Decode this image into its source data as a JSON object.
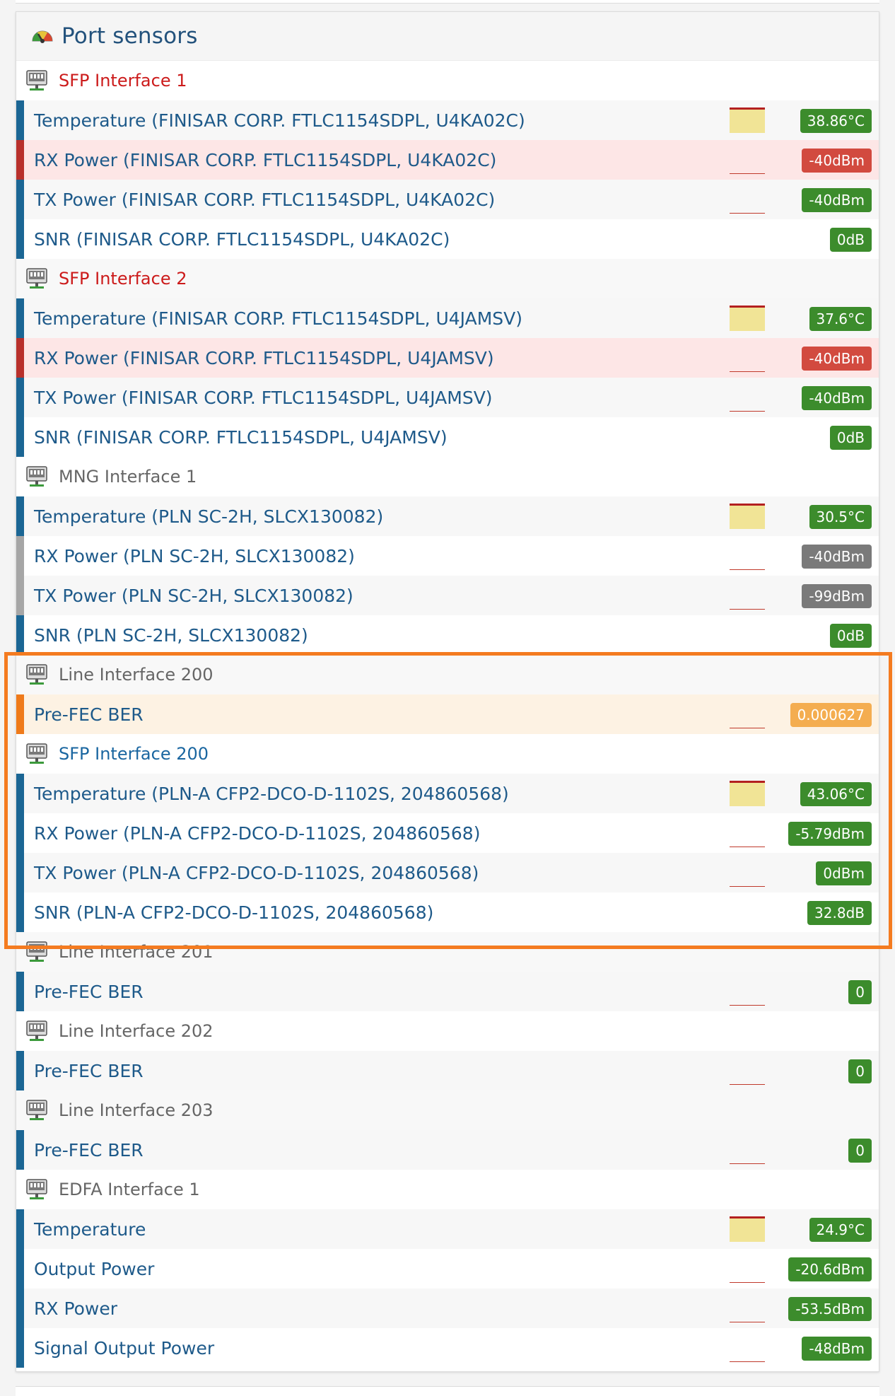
{
  "panel": {
    "title": "Port sensors",
    "icon": "gauge-icon"
  },
  "colors": {
    "accent_blue": "#1b6694",
    "ok_green": "#3c8c2c",
    "alert_red": "#d24a3f",
    "warn_orange": "#f4ad50",
    "muted_grey": "#7a7a7a",
    "highlight_orange": "#f47b20"
  },
  "groups": [
    {
      "label": "SFP Interface 1",
      "state": "down",
      "sensors": [
        {
          "label": "Temperature (FINISAR CORP. FTLC1154SDPL, U4KA02C)",
          "value": "38.86°C",
          "status": "ok",
          "spark": "fill"
        },
        {
          "label": "RX Power (FINISAR CORP. FTLC1154SDPL, U4KA02C)",
          "value": "-40dBm",
          "status": "bad",
          "spark": "line"
        },
        {
          "label": "TX Power (FINISAR CORP. FTLC1154SDPL, U4KA02C)",
          "value": "-40dBm",
          "status": "ok",
          "spark": "line"
        },
        {
          "label": "SNR (FINISAR CORP. FTLC1154SDPL, U4KA02C)",
          "value": "0dB",
          "status": "ok",
          "spark": "none"
        }
      ]
    },
    {
      "label": "SFP Interface 2",
      "state": "down",
      "sensors": [
        {
          "label": "Temperature (FINISAR CORP. FTLC1154SDPL, U4JAMSV)",
          "value": "37.6°C",
          "status": "ok",
          "spark": "fill"
        },
        {
          "label": "RX Power (FINISAR CORP. FTLC1154SDPL, U4JAMSV)",
          "value": "-40dBm",
          "status": "bad",
          "spark": "line"
        },
        {
          "label": "TX Power (FINISAR CORP. FTLC1154SDPL, U4JAMSV)",
          "value": "-40dBm",
          "status": "ok",
          "spark": "line"
        },
        {
          "label": "SNR (FINISAR CORP. FTLC1154SDPL, U4JAMSV)",
          "value": "0dB",
          "status": "ok",
          "spark": "none"
        }
      ]
    },
    {
      "label": "MNG Interface 1",
      "state": "neutral",
      "sensors": [
        {
          "label": "Temperature (PLN SC-2H, SLCX130082)",
          "value": "30.5°C",
          "status": "ok",
          "spark": "fill"
        },
        {
          "label": "RX Power (PLN SC-2H, SLCX130082)",
          "value": "-40dBm",
          "status": "grey",
          "spark": "line"
        },
        {
          "label": "TX Power (PLN SC-2H, SLCX130082)",
          "value": "-99dBm",
          "status": "grey",
          "spark": "line"
        },
        {
          "label": "SNR (PLN SC-2H, SLCX130082)",
          "value": "0dB",
          "status": "ok",
          "spark": "none"
        }
      ]
    },
    {
      "label": "Line Interface 200",
      "state": "neutral",
      "sensors": [
        {
          "label": "Pre-FEC BER",
          "value": "0.000627",
          "status": "warn",
          "spark": "line"
        }
      ]
    },
    {
      "label": "SFP Interface 200",
      "state": "up",
      "sensors": [
        {
          "label": "Temperature (PLN-A CFP2-DCO-D-1102S, 204860568)",
          "value": "43.06°C",
          "status": "ok",
          "spark": "fill"
        },
        {
          "label": "RX Power (PLN-A CFP2-DCO-D-1102S, 204860568)",
          "value": "-5.79dBm",
          "status": "ok",
          "spark": "line"
        },
        {
          "label": "TX Power (PLN-A CFP2-DCO-D-1102S, 204860568)",
          "value": "0dBm",
          "status": "ok",
          "spark": "line"
        },
        {
          "label": "SNR (PLN-A CFP2-DCO-D-1102S, 204860568)",
          "value": "32.8dB",
          "status": "ok",
          "spark": "none"
        }
      ]
    },
    {
      "label": "Line Interface 201",
      "state": "neutral",
      "sensors": [
        {
          "label": "Pre-FEC BER",
          "value": "0",
          "status": "ok",
          "spark": "line"
        }
      ]
    },
    {
      "label": "Line Interface 202",
      "state": "neutral",
      "sensors": [
        {
          "label": "Pre-FEC BER",
          "value": "0",
          "status": "ok",
          "spark": "line"
        }
      ]
    },
    {
      "label": "Line Interface 203",
      "state": "neutral",
      "sensors": [
        {
          "label": "Pre-FEC BER",
          "value": "0",
          "status": "ok",
          "spark": "line"
        }
      ]
    },
    {
      "label": "EDFA Interface 1",
      "state": "neutral",
      "sensors": [
        {
          "label": "Temperature",
          "value": "24.9°C",
          "status": "ok",
          "spark": "fill"
        },
        {
          "label": "Output Power",
          "value": "-20.6dBm",
          "status": "ok",
          "spark": "line"
        },
        {
          "label": "RX Power",
          "value": "-53.5dBm",
          "status": "ok",
          "spark": "line"
        },
        {
          "label": "Signal Output Power",
          "value": "-48dBm",
          "status": "ok",
          "spark": "line"
        }
      ]
    }
  ]
}
